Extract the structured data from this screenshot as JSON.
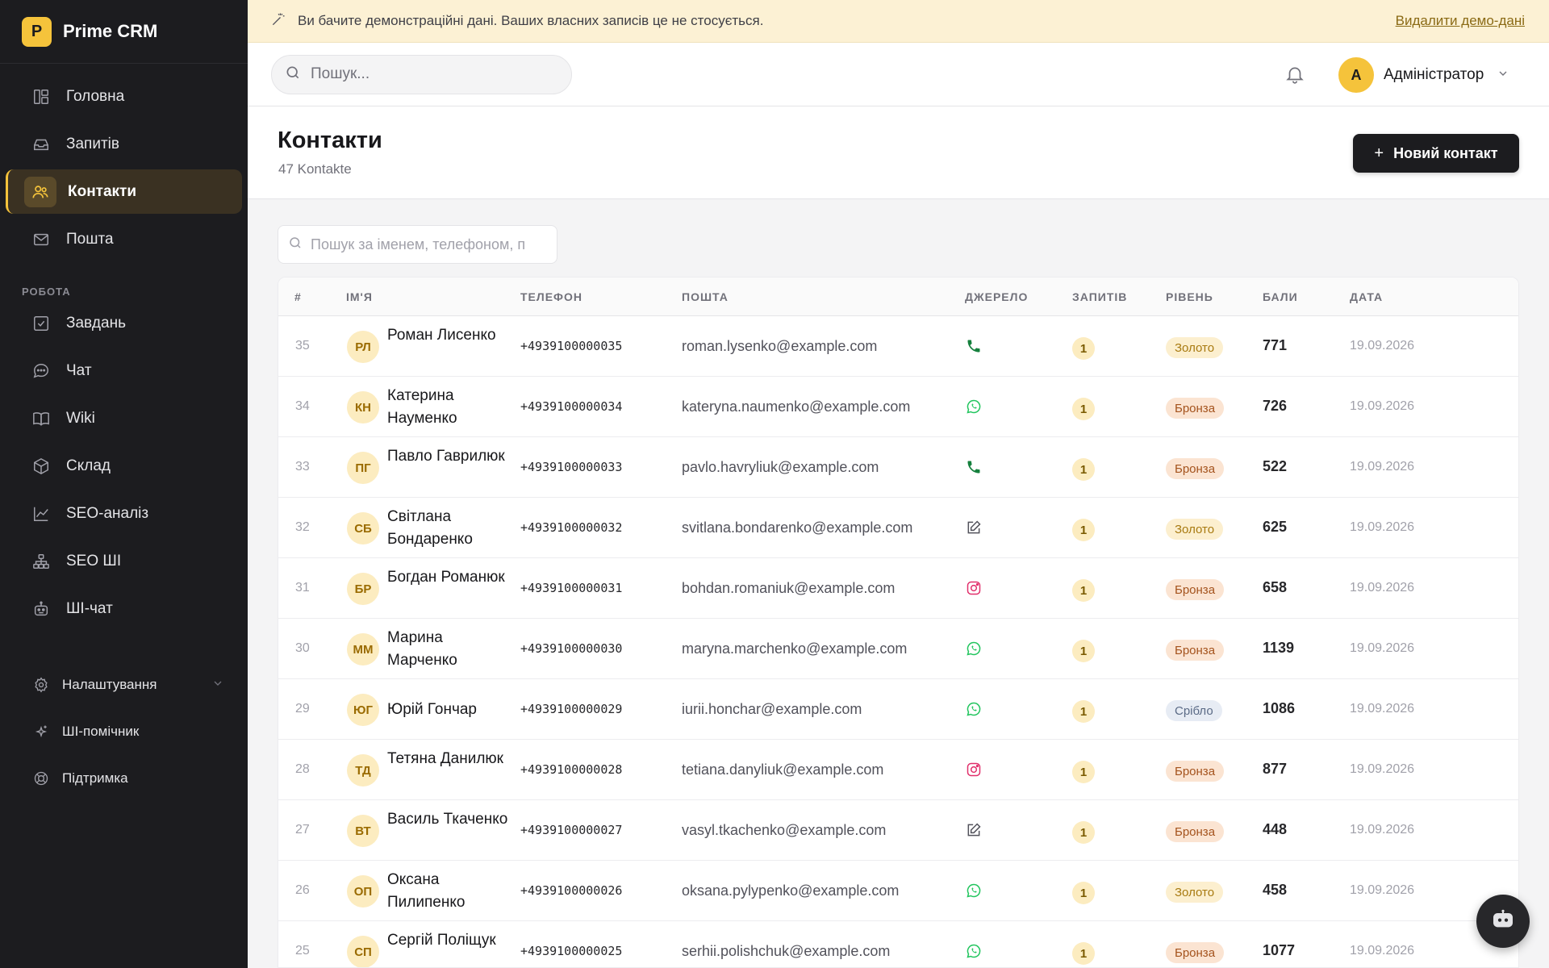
{
  "app": {
    "logo_letter": "P",
    "name": "Prime CRM"
  },
  "sidebar": {
    "main_items": [
      {
        "label": "Головна",
        "icon": "dashboard-icon"
      },
      {
        "label": "Запитів",
        "icon": "inbox-icon"
      },
      {
        "label": "Контакти",
        "icon": "users-icon",
        "active": true
      },
      {
        "label": "Пошта",
        "icon": "mail-icon"
      }
    ],
    "section_label": "РОБОТА",
    "work_items": [
      {
        "label": "Завдань",
        "icon": "checkbox-icon"
      },
      {
        "label": "Чат",
        "icon": "chat-icon"
      },
      {
        "label": "Wiki",
        "icon": "book-icon"
      },
      {
        "label": "Склад",
        "icon": "box-icon"
      },
      {
        "label": "SEO-аналіз",
        "icon": "chart-line-icon"
      },
      {
        "label": "SEO ШІ",
        "icon": "network-icon"
      },
      {
        "label": "ШІ-чат",
        "icon": "robot-icon"
      }
    ],
    "bottom_items": [
      {
        "label": "Налаштування",
        "icon": "gear-icon"
      },
      {
        "label": "ШІ-помічник",
        "icon": "sparkle-icon"
      },
      {
        "label": "Підтримка",
        "icon": "lifebuoy-icon"
      }
    ]
  },
  "banner": {
    "text": "Ви бачите демонстраційні дані. Ваших власних записів це не стосується.",
    "link": "Видалити демо-дані"
  },
  "topbar": {
    "search_placeholder": "Пошук...",
    "user_initial": "A",
    "user_name": "Адміністратор"
  },
  "page": {
    "title": "Контакти",
    "subtitle": "47 Kontakte",
    "new_button": "Новий контакт",
    "filter_placeholder": "Пошук за іменем, телефоном, п"
  },
  "table": {
    "columns": [
      "#",
      "ІМ'Я",
      "ТЕЛЕФОН",
      "ПОШТА",
      "ДЖЕРЕЛО",
      "ЗАПИТІВ",
      "РІВЕНЬ",
      "БАЛИ",
      "ДАТА"
    ],
    "rows": [
      {
        "num": "35",
        "initials": "РЛ",
        "name": "Роман Лисенко",
        "phone": "+4939100000035",
        "email": "roman.lysenko@example.com",
        "source": "phone",
        "requests": "1",
        "level": "Золото",
        "level_type": "gold",
        "points": "771",
        "date": "19.09.2026"
      },
      {
        "num": "34",
        "initials": "КН",
        "name": "Катерина Науменко",
        "phone": "+4939100000034",
        "email": "kateryna.naumenko@example.com",
        "source": "whatsapp",
        "requests": "1",
        "level": "Бронза",
        "level_type": "bronze",
        "points": "726",
        "date": "19.09.2026"
      },
      {
        "num": "33",
        "initials": "ПГ",
        "name": "Павло Гаврилюк",
        "phone": "+4939100000033",
        "email": "pavlo.havryliuk@example.com",
        "source": "phone",
        "requests": "1",
        "level": "Бронза",
        "level_type": "bronze",
        "points": "522",
        "date": "19.09.2026"
      },
      {
        "num": "32",
        "initials": "СБ",
        "name": "Світлана Бондаренко",
        "phone": "+4939100000032",
        "email": "svitlana.bondarenko@example.com",
        "source": "form",
        "requests": "1",
        "level": "Золото",
        "level_type": "gold",
        "points": "625",
        "date": "19.09.2026"
      },
      {
        "num": "31",
        "initials": "БР",
        "name": "Богдан Романюк",
        "phone": "+4939100000031",
        "email": "bohdan.romaniuk@example.com",
        "source": "instagram",
        "requests": "1",
        "level": "Бронза",
        "level_type": "bronze",
        "points": "658",
        "date": "19.09.2026"
      },
      {
        "num": "30",
        "initials": "ММ",
        "name": "Марина Марченко",
        "phone": "+4939100000030",
        "email": "maryna.marchenko@example.com",
        "source": "whatsapp",
        "requests": "1",
        "level": "Бронза",
        "level_type": "bronze",
        "points": "1139",
        "date": "19.09.2026"
      },
      {
        "num": "29",
        "initials": "ЮГ",
        "name": "Юрій Гончар",
        "phone": "+4939100000029",
        "email": "iurii.honchar@example.com",
        "source": "whatsapp",
        "requests": "1",
        "level": "Срібло",
        "level_type": "silver",
        "points": "1086",
        "date": "19.09.2026",
        "single_line": true
      },
      {
        "num": "28",
        "initials": "ТД",
        "name": "Тетяна Данилюк",
        "phone": "+4939100000028",
        "email": "tetiana.danyliuk@example.com",
        "source": "instagram",
        "requests": "1",
        "level": "Бронза",
        "level_type": "bronze",
        "points": "877",
        "date": "19.09.2026"
      },
      {
        "num": "27",
        "initials": "ВТ",
        "name": "Василь Ткаченко",
        "phone": "+4939100000027",
        "email": "vasyl.tkachenko@example.com",
        "source": "form",
        "requests": "1",
        "level": "Бронза",
        "level_type": "bronze",
        "points": "448",
        "date": "19.09.2026"
      },
      {
        "num": "26",
        "initials": "ОП",
        "name": "Оксана Пилипенко",
        "phone": "+4939100000026",
        "email": "oksana.pylypenko@example.com",
        "source": "whatsapp",
        "requests": "1",
        "level": "Золото",
        "level_type": "gold",
        "points": "458",
        "date": "19.09.2026"
      },
      {
        "num": "25",
        "initials": "СП",
        "name": "Сергій Поліщук",
        "phone": "+4939100000025",
        "email": "serhii.polishchuk@example.com",
        "source": "whatsapp",
        "requests": "1",
        "level": "Бронза",
        "level_type": "bronze",
        "points": "1077",
        "date": "19.09.2026"
      }
    ]
  },
  "colors": {
    "accent": "#f5c33b",
    "sidebar": "#1c1c1f",
    "banner": "#fcf1d4",
    "phone": "#15803d",
    "whatsapp": "#22c55e",
    "instagram": "#e1306c",
    "form": "#52525b"
  }
}
